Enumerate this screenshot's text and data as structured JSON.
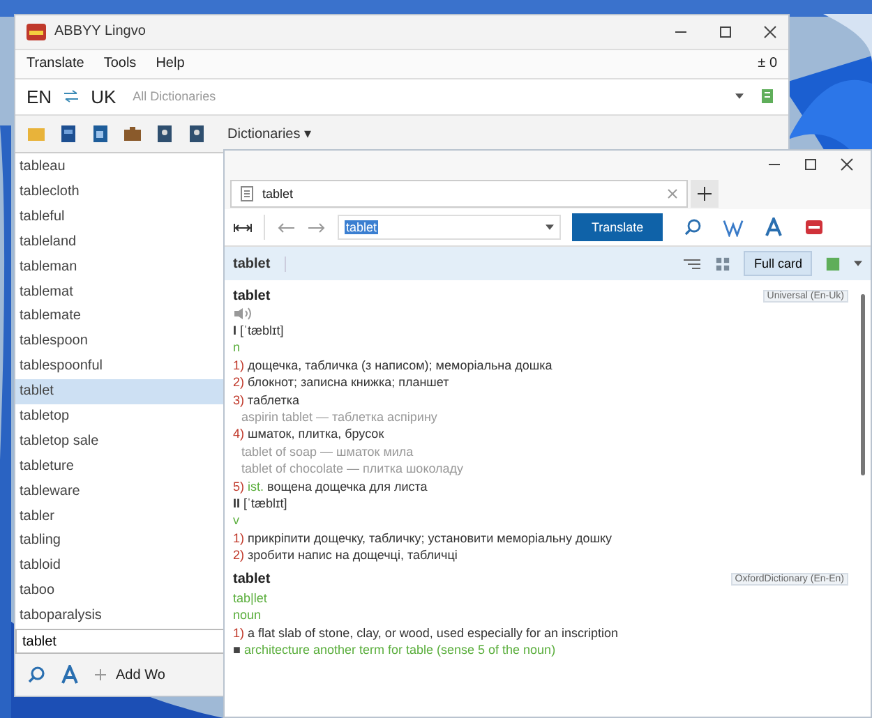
{
  "main_window": {
    "title": "ABBYY Lingvo",
    "menu": [
      "Translate",
      "Tools",
      "Help"
    ],
    "menu_right": "± 0",
    "source_lang": "EN",
    "target_lang": "UK",
    "dictionaries_field": "All Dictionaries",
    "dictionaries_menu": "Dictionaries ▾",
    "word_list": [
      {
        "text": "tableau",
        "selected": false
      },
      {
        "text": "tablecloth",
        "selected": false
      },
      {
        "text": "tableful",
        "selected": false
      },
      {
        "text": "tableland",
        "selected": false
      },
      {
        "text": "tableman",
        "selected": false
      },
      {
        "text": "tablemat",
        "selected": false
      },
      {
        "text": "tablemate",
        "selected": false
      },
      {
        "text": "tablespoon",
        "selected": false
      },
      {
        "text": "tablespoonful",
        "selected": false
      },
      {
        "text": "tablet",
        "selected": true
      },
      {
        "text": "tabletop",
        "selected": false
      },
      {
        "text": "tabletop sale",
        "selected": false
      },
      {
        "text": "tableture",
        "selected": false
      },
      {
        "text": "tableware",
        "selected": false
      },
      {
        "text": "tabler",
        "selected": false
      },
      {
        "text": "tabling",
        "selected": false
      },
      {
        "text": "tabloid",
        "selected": false
      },
      {
        "text": "taboo",
        "selected": false
      },
      {
        "text": "taboparalysis",
        "selected": false
      }
    ],
    "search_value": "tablet",
    "add_word": "Add Wo"
  },
  "card_window": {
    "tab": "tablet",
    "query": "tablet",
    "translate_button": "Translate",
    "header_word": "tablet",
    "full_card": "Full card",
    "entries": [
      {
        "headword": "tablet",
        "dictionary": "Universal (En-Uk)",
        "lines": [
          {
            "kind": "sound"
          },
          {
            "kind": "transcription",
            "num": "I",
            "text": "[ˈtæblɪt]"
          },
          {
            "kind": "pos",
            "text": "n"
          },
          {
            "kind": "sense",
            "num": "1)",
            "text": "дощечка, табличка (з написом); меморіальна дошка"
          },
          {
            "kind": "sense",
            "num": "2)",
            "text": "блокнот; записна книжка; планшет"
          },
          {
            "kind": "sense",
            "num": "3)",
            "text": "таблетка"
          },
          {
            "kind": "example",
            "text": "aspirin tablet — таблетка аспірину"
          },
          {
            "kind": "sense",
            "num": "4)",
            "text": "шматок, плитка, брусок"
          },
          {
            "kind": "example",
            "text": "tablet of soap — шматок мила"
          },
          {
            "kind": "example",
            "text": "tablet of chocolate — плитка шоколаду"
          },
          {
            "kind": "sense",
            "num": "5)",
            "label": "ist.",
            "text": "вощена дощечка для листа"
          },
          {
            "kind": "transcription",
            "num": "II",
            "text": "[ˈtæblɪt]"
          },
          {
            "kind": "pos",
            "text": "v"
          },
          {
            "kind": "sense",
            "num": "1)",
            "text": "прикріпити дощечку, табличку; установити меморіальну дошку"
          },
          {
            "kind": "sense",
            "num": "2)",
            "text": "зробити напис на дощечці, табличці"
          }
        ]
      },
      {
        "headword": "tablet",
        "dictionary": "OxfordDictionary (En-En)",
        "lines": [
          {
            "kind": "syllables",
            "text": "tab|let"
          },
          {
            "kind": "pos",
            "text": "noun"
          },
          {
            "kind": "sense",
            "num": "1)",
            "text": "a flat slab of stone, clay, or wood, used especially for an inscription"
          },
          {
            "kind": "note",
            "num": "■",
            "text": "architecture another term for table (sense 5 of the noun)"
          }
        ]
      }
    ]
  }
}
